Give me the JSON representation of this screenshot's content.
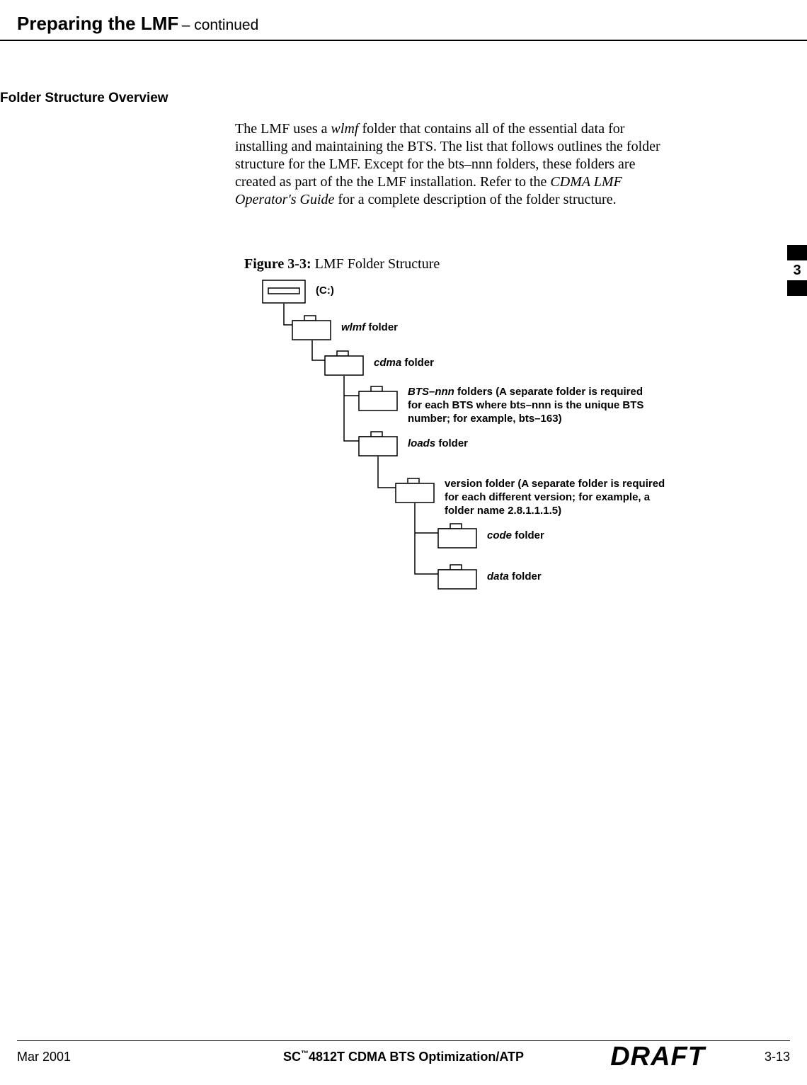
{
  "header": {
    "title": "Preparing the LMF",
    "continued": " – continued"
  },
  "section": {
    "heading": "Folder Structure Overview"
  },
  "body": {
    "p1_a": "The LMF uses a ",
    "p1_it1": "wlmf",
    "p1_b": " folder that contains all of the essential data for installing and maintaining the BTS. The list that follows outlines the folder structure for the LMF. Except for the bts–nnn folders, these folders are created as part of the the LMF installation. Refer to the ",
    "p1_it2": "CDMA LMF Operator's Guide",
    "p1_c": " for a complete description of the folder structure."
  },
  "figure": {
    "caption_bold": "Figure 3-3:",
    "caption_rest": " LMF Folder Structure"
  },
  "tab": {
    "chapter": "3"
  },
  "tree": {
    "c_drive": "(C:)",
    "wlmf_it": "wlmf",
    "wlmf_rest": " folder",
    "cdma_it": "cdma",
    "cdma_rest": " folder",
    "bts_it": "BTS–nnn",
    "bts_rest": " folders (A separate folder is required for each BTS where bts–nnn is the unique BTS number; for example, bts–163)",
    "loads_it": "loads",
    "loads_rest": " folder",
    "version": "version folder (A separate folder is required for each different version; for example, a folder name 2.8.1.1.1.5)",
    "code_it": "code",
    "code_rest": " folder",
    "data_it": "data",
    "data_rest": " folder"
  },
  "footer": {
    "date": "Mar 2001",
    "center_a": "SC",
    "center_tm": "™",
    "center_b": "4812T CDMA BTS Optimization/ATP",
    "draft": "DRAFT",
    "page": "3-13"
  }
}
